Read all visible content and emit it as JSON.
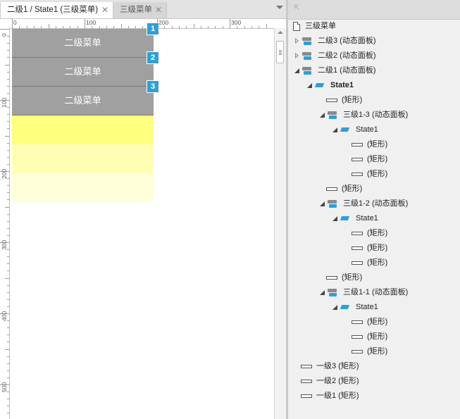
{
  "tabs": {
    "active_label": "二级1 / State1 (三级菜单)",
    "inactive_label": "三级菜单",
    "close_glyph": "✕"
  },
  "rulers": {
    "top_labels": [
      "0",
      "100",
      "200",
      "300"
    ],
    "left_labels": [
      "0",
      "100",
      "200",
      "300",
      "400",
      "500"
    ]
  },
  "canvas": {
    "menu_items": [
      {
        "label": "二级菜单",
        "badge": "1"
      },
      {
        "label": "二级菜单",
        "badge": "2"
      },
      {
        "label": "二级菜单",
        "badge": "3"
      }
    ],
    "colors": {
      "menu_gray": "#a0a0a0",
      "badge_blue": "#2f9fd7",
      "yellow_1": "#ffff80",
      "yellow_2": "#ffffb3",
      "yellow_3": "#ffffd9"
    }
  },
  "outline": {
    "rows": [
      {
        "text": "三级菜单",
        "icon": "page-icon",
        "expander": "none",
        "level": 0
      },
      {
        "text": "二级3 (动态面板)",
        "icon": "dynamic-panel-icon",
        "expander": "collapsed",
        "level": 0
      },
      {
        "text": "二级2 (动态面板)",
        "icon": "dynamic-panel-icon",
        "expander": "collapsed",
        "level": 0
      },
      {
        "text": "二级1 (动态面板)",
        "icon": "dynamic-panel-icon",
        "expander": "expanded",
        "level": 0
      },
      {
        "text": "State1",
        "icon": "state-icon",
        "expander": "expanded",
        "level": 1,
        "bold": true
      },
      {
        "text": "(矩形)",
        "icon": "rectangle-icon",
        "expander": "none",
        "level": 2
      },
      {
        "text": "三级1-3 (动态面板)",
        "icon": "dynamic-panel-icon",
        "expander": "expanded",
        "level": 2
      },
      {
        "text": "State1",
        "icon": "state-icon",
        "expander": "expanded",
        "level": 3
      },
      {
        "text": "(矩形)",
        "icon": "rectangle-icon",
        "expander": "none",
        "level": 4
      },
      {
        "text": "(矩形)",
        "icon": "rectangle-icon",
        "expander": "none",
        "level": 4
      },
      {
        "text": "(矩形)",
        "icon": "rectangle-icon",
        "expander": "none",
        "level": 4
      },
      {
        "text": "(矩形)",
        "icon": "rectangle-icon",
        "expander": "none",
        "level": 2
      },
      {
        "text": "三级1-2 (动态面板)",
        "icon": "dynamic-panel-icon",
        "expander": "expanded",
        "level": 2
      },
      {
        "text": "State1",
        "icon": "state-icon",
        "expander": "expanded",
        "level": 3
      },
      {
        "text": "(矩形)",
        "icon": "rectangle-icon",
        "expander": "none",
        "level": 4
      },
      {
        "text": "(矩形)",
        "icon": "rectangle-icon",
        "expander": "none",
        "level": 4
      },
      {
        "text": "(矩形)",
        "icon": "rectangle-icon",
        "expander": "none",
        "level": 4
      },
      {
        "text": "(矩形)",
        "icon": "rectangle-icon",
        "expander": "none",
        "level": 2
      },
      {
        "text": "三级1-1 (动态面板)",
        "icon": "dynamic-panel-icon",
        "expander": "expanded",
        "level": 2
      },
      {
        "text": "State1",
        "icon": "state-icon",
        "expander": "expanded",
        "level": 3
      },
      {
        "text": "(矩形)",
        "icon": "rectangle-icon",
        "expander": "none",
        "level": 4
      },
      {
        "text": "(矩形)",
        "icon": "rectangle-icon",
        "expander": "none",
        "level": 4
      },
      {
        "text": "(矩形)",
        "icon": "rectangle-icon",
        "expander": "none",
        "level": 4
      },
      {
        "text": "一级3 (矩形)",
        "icon": "rectangle-icon",
        "expander": "none",
        "level": 0
      },
      {
        "text": "一级2 (矩形)",
        "icon": "rectangle-icon",
        "expander": "none",
        "level": 0
      },
      {
        "text": "一级1 (矩形)",
        "icon": "rectangle-icon",
        "expander": "none",
        "level": 0
      }
    ]
  }
}
